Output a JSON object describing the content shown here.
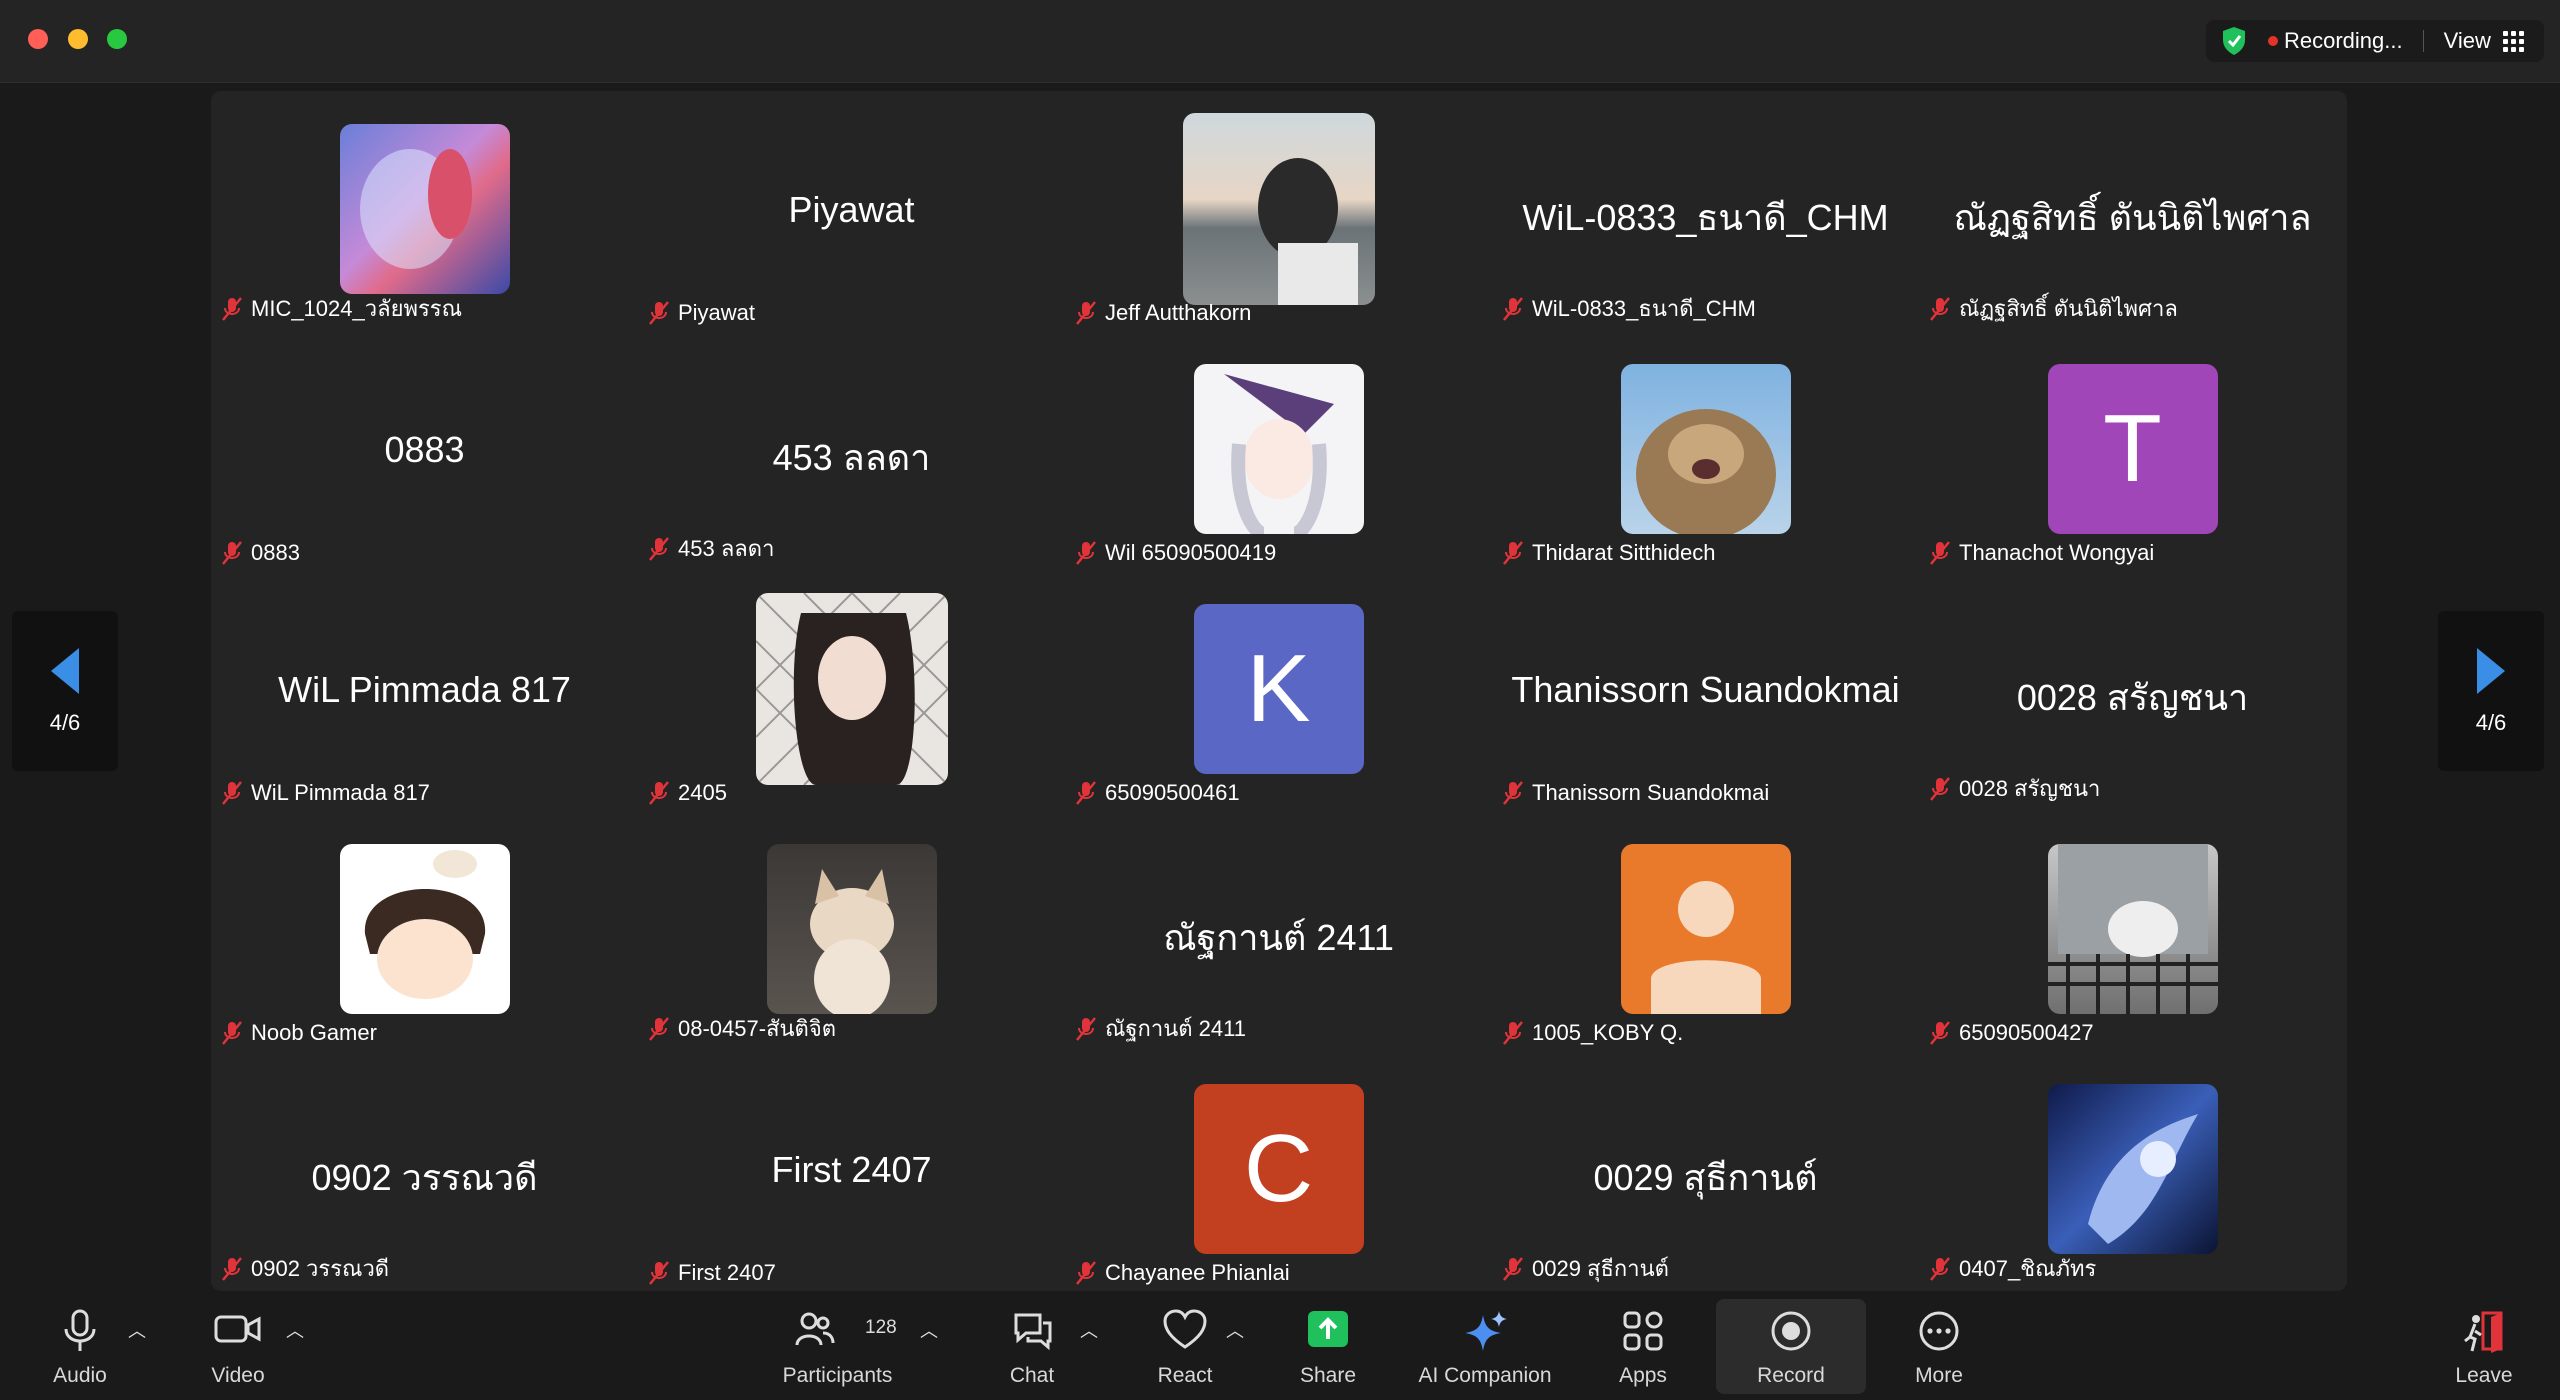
{
  "window": {
    "recording_label": "Recording...",
    "view_label": "View"
  },
  "pagination": {
    "left": "4/6",
    "right": "4/6"
  },
  "tiles": [
    {
      "label": "MIC_1024_วลัยพรรณ"
    },
    {
      "label": "Piyawat",
      "bigname": "Piyawat"
    },
    {
      "label": "Jeff Autthakorn"
    },
    {
      "label": "WiL-0833_ธนาดี_CHM",
      "bigname": "WiL-0833_ธนาดี_CHM"
    },
    {
      "label": "ณัฏฐสิทธิ์ ตันนิติไพศาล",
      "bigname": "ณัฏฐสิทธิ์ ตันนิติไพศาล"
    },
    {
      "label": "0883",
      "bigname": "0883"
    },
    {
      "label": "453 ลลดา",
      "bigname": "453 ลลดา"
    },
    {
      "label": "Wil 65090500419"
    },
    {
      "label": "Thidarat Sitthidech"
    },
    {
      "label": "Thanachot Wongyai",
      "letter": "T"
    },
    {
      "label": "WiL Pimmada 817",
      "bigname": "WiL Pimmada 817"
    },
    {
      "label": "2405"
    },
    {
      "label": "65090500461",
      "letter": "K"
    },
    {
      "label": "Thanissorn Suandokmai",
      "bigname": "Thanissorn Suandokmai"
    },
    {
      "label": "0028 สรัญชนา",
      "bigname": "0028 สรัญชนา"
    },
    {
      "label": "Noob Gamer"
    },
    {
      "label": "08-0457-สันติจิต"
    },
    {
      "label": "ณัฐกานต์ 2411",
      "bigname": "ณัฐกานต์ 2411"
    },
    {
      "label": "1005_KOBY Q."
    },
    {
      "label": "65090500427"
    },
    {
      "label": "0902 วรรณวดี",
      "bigname": "0902 วรรณวดี"
    },
    {
      "label": "First 2407",
      "bigname": "First 2407"
    },
    {
      "label": "Chayanee Phianlai",
      "letter": "C"
    },
    {
      "label": "0029 สุธีกานต์",
      "bigname": "0029 สุธีกานต์"
    },
    {
      "label": "0407_ชิณภัทร"
    }
  ],
  "toolbar": {
    "audio": "Audio",
    "video": "Video",
    "participants": "Participants",
    "participants_count": "128",
    "chat": "Chat",
    "react": "React",
    "share": "Share",
    "ai_companion": "AI Companion",
    "apps": "Apps",
    "record": "Record",
    "more": "More",
    "leave": "Leave"
  },
  "colors": {
    "accent_green": "#20c05c",
    "letter_T": "#a046b8",
    "letter_K": "#5b67c4",
    "letter_C": "#c23f1f",
    "avatar_orange": "#e97a2b",
    "mute_red": "#e0343a"
  }
}
